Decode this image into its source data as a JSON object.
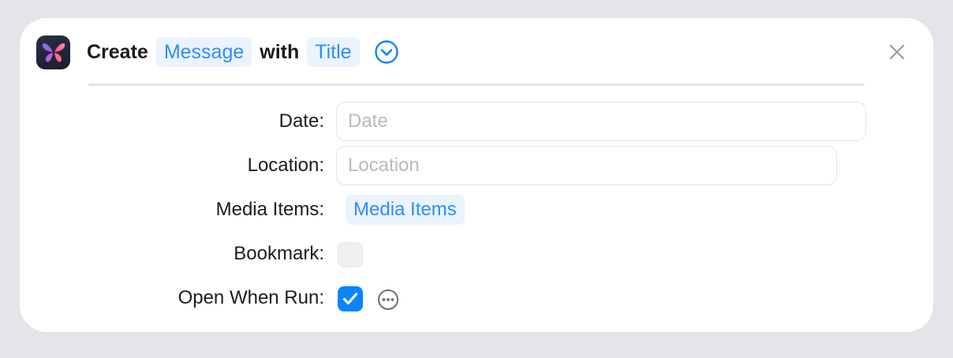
{
  "header": {
    "verb": "Create",
    "object_token": "Message",
    "connector": "with",
    "title_token": "Title",
    "app_icon": "butterfly-app-icon"
  },
  "params": {
    "date": {
      "label": "Date:",
      "placeholder": "Date",
      "value": ""
    },
    "location": {
      "label": "Location:",
      "placeholder": "Location",
      "value": ""
    },
    "media_items": {
      "label": "Media Items:",
      "token": "Media Items"
    },
    "bookmark": {
      "label": "Bookmark:",
      "checked": false
    },
    "open_when_run": {
      "label": "Open When Run:",
      "checked": true
    }
  },
  "colors": {
    "accent": "#0a84ff",
    "token_text": "#2f8ef4",
    "token_bg": "#ebf3fd",
    "background": "#e3e5e8"
  }
}
